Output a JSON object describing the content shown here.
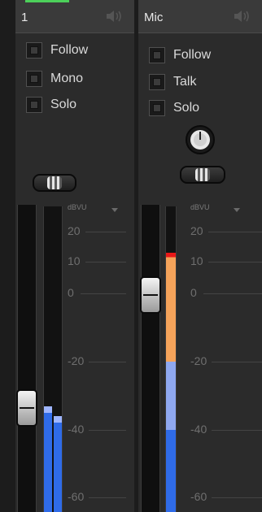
{
  "channels": [
    {
      "title": "1",
      "speaker_icon": "speaker-icon",
      "toggles": [
        {
          "label": "Follow",
          "checked": false
        },
        {
          "label": "Mono",
          "checked": false
        },
        {
          "label": "Solo",
          "checked": false
        }
      ],
      "has_gain_knob": false,
      "fader_level_db": -33,
      "meter": {
        "left_level_db": -33,
        "right_level_db": -36,
        "peak_color": "#9fb6ff"
      }
    },
    {
      "title": "Mic",
      "speaker_icon": "speaker-icon",
      "toggles": [
        {
          "label": "Follow",
          "checked": false
        },
        {
          "label": "Talk",
          "checked": false
        },
        {
          "label": "Solo",
          "checked": false
        }
      ],
      "has_gain_knob": true,
      "fader_level_db": 0,
      "meter": {
        "level_db": 13,
        "colors": [
          "#2f6be8",
          "#8fa8f0",
          "#f5a35a",
          "#e81818"
        ]
      }
    }
  ],
  "scale": {
    "unit": "dBVU",
    "ticks": [
      "20",
      "10",
      "0",
      "-20",
      "-40",
      "-60"
    ]
  },
  "colors": {
    "accent": "#4cd05a",
    "meter_blue": "#2f6be8",
    "meter_light_blue": "#8fa8f0",
    "meter_orange": "#f5a35a",
    "meter_red": "#e81818"
  }
}
